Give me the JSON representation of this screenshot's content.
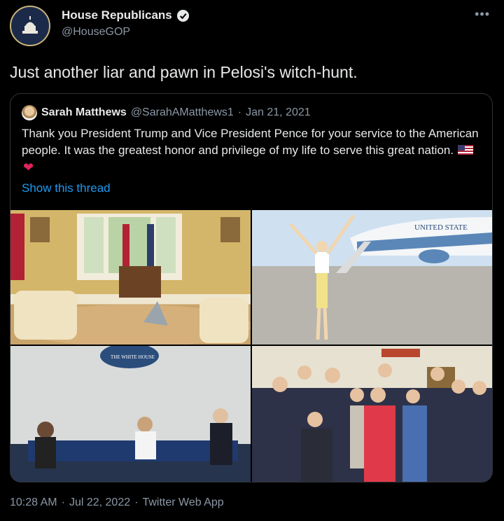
{
  "author": {
    "display_name": "House Republicans",
    "handle": "@HouseGOP",
    "verified": true
  },
  "tweet": {
    "text": "Just another liar and pawn in Pelosi's witch-hunt."
  },
  "quoted_tweet": {
    "display_name": "Sarah Matthews",
    "handle": "@SarahAMatthews1",
    "separator": "·",
    "date": "Jan 21, 2021",
    "text": "Thank you President Trump and Vice President Pence for your service to the American people. It was the greatest honor and privilege of my life to serve this great nation.",
    "show_thread": "Show this thread"
  },
  "photos": {
    "p2_label": "UNITED STATE",
    "p3_label": "THE WHITE HOUSE"
  },
  "footer": {
    "time": "10:28 AM",
    "separator": "·",
    "date": "Jul 22, 2022",
    "separator2": "·",
    "source": "Twitter Web App"
  },
  "icons": [
    "capitol-seal-icon",
    "verified-badge-icon",
    "more-options-icon",
    "us-flag-emoji",
    "red-heart-emoji"
  ],
  "colors": {
    "background": "#000000",
    "text": "#e7e9ea",
    "muted": "#8b98a5",
    "link": "#1d9bf0"
  }
}
